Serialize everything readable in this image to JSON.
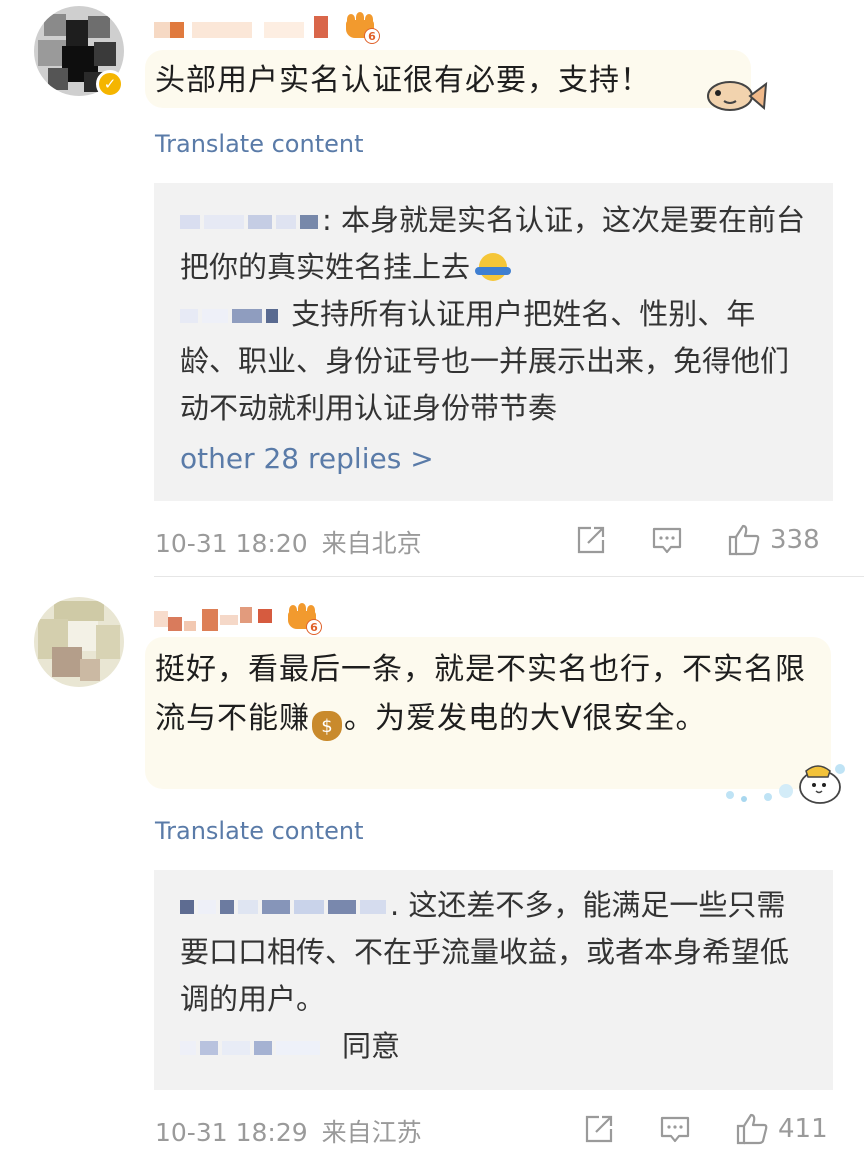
{
  "comments": [
    {
      "crown_level": "6",
      "body": "头部用户实名认证很有必要，支持！",
      "translate": "Translate content",
      "replies": [
        {
          "text": ": 本身就是实名认证，这次是要在前台把你的真实姓名挂上去"
        },
        {
          "text": " 支持所有认证用户把姓名、性别、年龄、职业、身份证号也一并展示出来，免得他们动不动就利用认证身份带节奏"
        }
      ],
      "more_replies": "other 28 replies >",
      "time": "10-31 18:20",
      "location": "来自北京",
      "likes": "338"
    },
    {
      "crown_level": "6",
      "body_part1": "挺好，看最后一条，就是不实名也行，不实名限流与不能赚",
      "body_part2": "。为爱发电的大V很安全。",
      "translate": "Translate content",
      "replies": [
        {
          "text": ". 这还差不多，能满足一些只需要口口相传、不在乎流量收益，或者本身希望低调的用户。"
        },
        {
          "text": "同意"
        }
      ],
      "time": "10-31 18:29",
      "location": "来自江苏",
      "likes": "411"
    }
  ],
  "icons": [
    "verified-badge-icon",
    "crown-level-icon",
    "fish-sticker-icon",
    "money-bag-emoji-icon",
    "bubble-sticker-icon",
    "share-icon",
    "comment-icon",
    "like-icon"
  ],
  "colors": {
    "link": "#5a7ba8",
    "meta": "#9a9a9a",
    "reply_bg": "#f2f2f2",
    "bubble_bg": "#fdfaee"
  }
}
